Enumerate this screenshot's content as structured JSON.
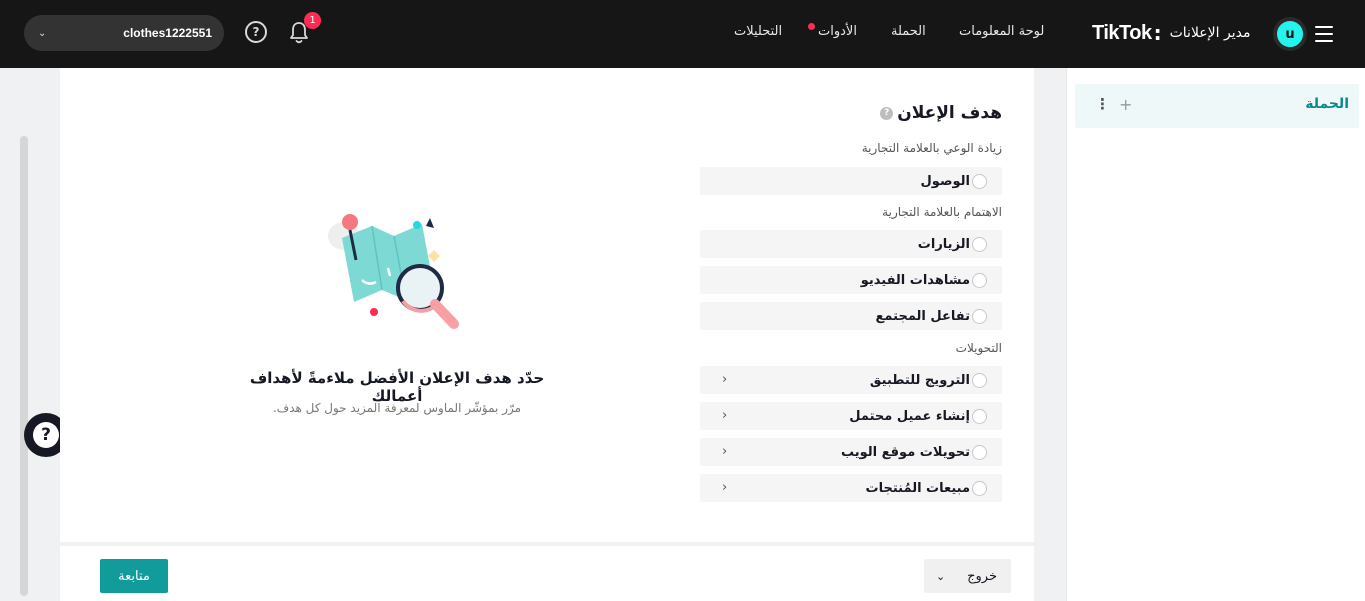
{
  "header": {
    "brand": "TikTok",
    "brand_sub": "مدير الإعلانات",
    "avatar_letter": "u",
    "nav": {
      "dashboard": "لوحة المعلومات",
      "campaign": "الحملة",
      "tools": "الأدوات",
      "analytics": "التحليلات"
    },
    "notifications_count": "1",
    "account_name": "clothes1222551"
  },
  "sidebar": {
    "campaign_label": "الحملة"
  },
  "objective": {
    "title": "هدف الإعلان",
    "sections": {
      "awareness": "زيادة الوعي بالعلامة التجارية",
      "consideration": "الاهتمام بالعلامة التجارية",
      "conversions": "التحويلات"
    },
    "options": {
      "reach": "الوصول",
      "traffic": "الزيارات",
      "video_views": "مشاهدات الفيديو",
      "community": "تفاعل المجتمع",
      "app_promotion": "الترويج للتطبيق",
      "lead_generation": "إنشاء عميل محتمل",
      "website_conversions": "تحويلات موقع الويب",
      "product_sales": "مبيعات المُنتجات"
    }
  },
  "hint": {
    "title": "حدّد هدف الإعلان الأفضل ملاءمةً لأهداف أعمالك",
    "subtitle": "مرّر بمؤشّر الماوس لمعرفة المزيد حول كل هدف."
  },
  "footer": {
    "exit": "خروج",
    "continue": "متابعة"
  },
  "colors": {
    "topbar": "#161616",
    "accent": "#129b9b",
    "avatar": "#25f4ee",
    "badge": "#fe2c55"
  }
}
